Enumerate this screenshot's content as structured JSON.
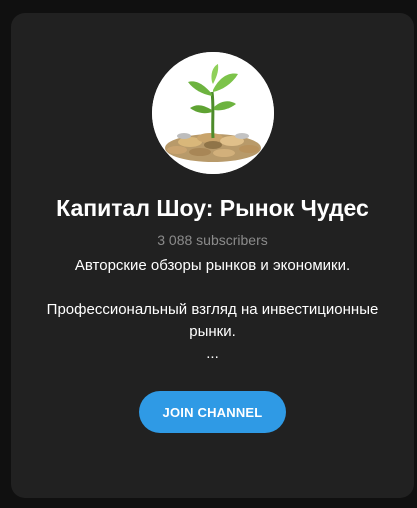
{
  "channel": {
    "title": "Капитал Шоу: Рынок Чудес",
    "subscribers": "3 088 subscribers",
    "description": [
      "Авторские обзоры рынков и экономики.",
      "",
      "Профессиональный взгляд на инвестиционные рынки.",
      "..."
    ],
    "avatar_icon": "plant-on-coins-icon"
  },
  "actions": {
    "join_label": "JOIN CHANNEL"
  },
  "colors": {
    "accent": "#2f9ae5",
    "card_bg": "#212121",
    "muted_text": "#8b8b8b"
  }
}
